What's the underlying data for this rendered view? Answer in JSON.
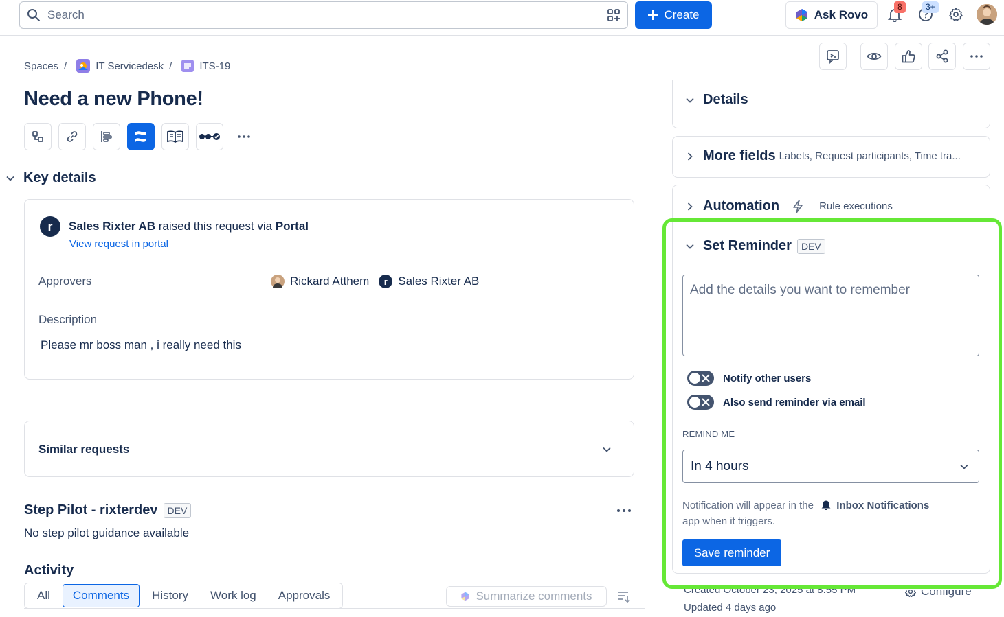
{
  "topbar": {
    "search_placeholder": "Search",
    "create_label": "Create",
    "rovo_label": "Ask Rovo",
    "notifications_count": "8",
    "help_count": "3+"
  },
  "breadcrumb": {
    "spaces": "Spaces",
    "separator": "/",
    "project": "IT Servicedesk",
    "issue_key": "ITS-19"
  },
  "issue": {
    "title": "Need a new Phone!"
  },
  "key_details": {
    "heading": "Key details",
    "requester": "Sales Rixter AB",
    "raised_text": "raised this request via",
    "channel": "Portal",
    "requester_initial": "r",
    "portal_link": "View request in portal",
    "approvers_label": "Approvers",
    "approvers": [
      "Rickard Atthem",
      "Sales Rixter AB"
    ],
    "description_label": "Description",
    "description": "Please mr boss man , i really need this"
  },
  "similar": {
    "title": "Similar requests"
  },
  "step_pilot": {
    "title": "Step Pilot - rixterdev",
    "tag": "DEV",
    "message": "No step pilot guidance available"
  },
  "activity": {
    "title": "Activity",
    "tabs": [
      "All",
      "Comments",
      "History",
      "Work log",
      "Approvals"
    ],
    "selected_tab": "Comments",
    "summarize_label": "Summarize comments"
  },
  "right_panel": {
    "details": "Details",
    "more_fields": "More fields",
    "more_fields_sub": "Labels, Request participants, Time tra...",
    "automation": "Automation",
    "automation_sub": "Rule executions"
  },
  "reminder": {
    "title": "Set Reminder",
    "tag": "DEV",
    "textarea_placeholder": "Add the details you want to remember",
    "notify_label": "Notify other users",
    "email_label": "Also send reminder via email",
    "remind_me_label": "REMIND ME",
    "remind_value": "In 4 hours",
    "notice_prefix": "Notification will appear in the",
    "notice_link": "Inbox Notifications",
    "notice_suffix": "app when it triggers.",
    "save_label": "Save reminder"
  },
  "footer": {
    "created": "Created October 23, 2025 at 8:55 PM",
    "updated": "Updated 4 days ago",
    "configure": "Configure"
  },
  "colors": {
    "brand_blue": "#0c66e4",
    "highlight_green": "#66e836",
    "text_primary": "#172b4d"
  }
}
